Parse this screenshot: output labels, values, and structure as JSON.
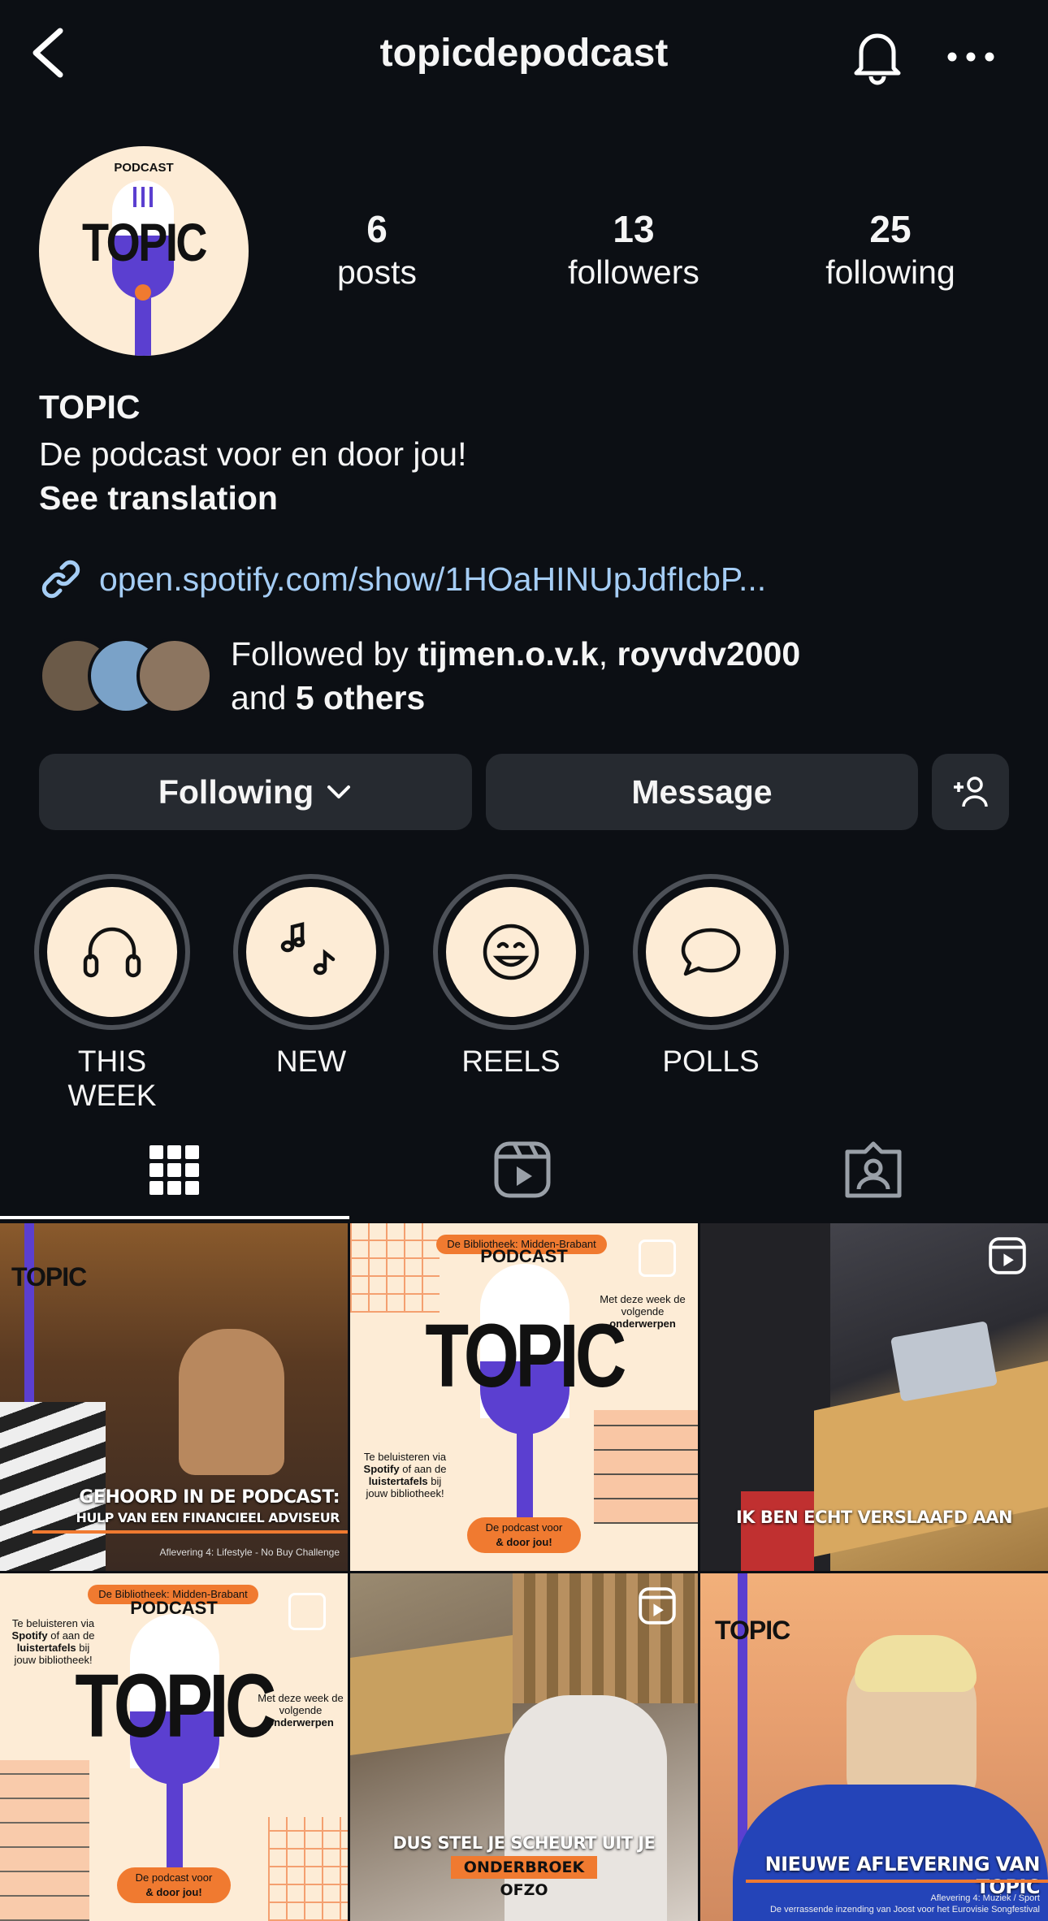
{
  "header": {
    "username": "topicdepodcast"
  },
  "profile": {
    "avatar_text_small": "PODCAST",
    "avatar_text_big": "TOPIC",
    "stats": [
      {
        "value": "6",
        "label": "posts"
      },
      {
        "value": "13",
        "label": "followers"
      },
      {
        "value": "25",
        "label": "following"
      }
    ],
    "name": "TOPIC",
    "bio": "De podcast voor en door jou!",
    "see_translation": "See translation",
    "link": "open.spotify.com/show/1HOaHINUpJdfIcbP...",
    "followed_prefix": "Followed by ",
    "followed_user1": "tijmen.o.v.k",
    "followed_sep": ", ",
    "followed_user2": "royvdv2000",
    "followed_and": "and ",
    "followed_others": "5 others"
  },
  "buttons": {
    "following": "Following",
    "message": "Message"
  },
  "highlights": [
    {
      "label": "THIS WEEK",
      "icon": "headphones-icon"
    },
    {
      "label": "NEW",
      "icon": "music-notes-icon"
    },
    {
      "label": "REELS",
      "icon": "smiley-icon"
    },
    {
      "label": "POLLS",
      "icon": "speech-bubble-icon"
    }
  ],
  "posts": [
    {
      "title": "GEHOORD IN DE PODCAST:",
      "subtitle": "HULP VAN EEN FINANCIEEL ADVISEUR",
      "footer": "Aflevering 4: Lifestyle - No Buy Challenge",
      "logo": "TOPIC"
    },
    {
      "tag": "De Bibliotheek: Midden-Brabant",
      "small": "PODCAST",
      "big": "TOPIC",
      "side_note": "Met deze week de volgende",
      "side_bold": "onderwerpen",
      "left_note": "Te beluisteren via",
      "left_b1": "Spotify",
      "left_mid": "of aan de",
      "left_b2": "luistertafels",
      "left_end": "bij jouw bibliotheek!",
      "pill": "De podcast voor",
      "pill2": "& door jou!"
    },
    {
      "caption": "IK BEN ECHT VERSLAAFD AAN"
    },
    {
      "tag": "De Bibliotheek: Midden-Brabant",
      "small": "PODCAST",
      "big": "TOPIC",
      "side_note": "Met deze week de volgende",
      "side_bold": "onderwerpen",
      "left_note": "Te beluisteren via",
      "left_b1": "Spotify",
      "left_mid": "of aan de",
      "left_b2": "luistertafels",
      "left_end": "bij jouw bibliotheek!",
      "pill": "De podcast voor",
      "pill2": "& door jou!"
    },
    {
      "caption": "DUS STEL JE SCHEURT UIT JE",
      "caption2": "ONDERBROEK OFZO"
    },
    {
      "logo": "TOPIC",
      "title": "NIEUWE AFLEVERING VAN TOPIC",
      "footer": "Aflevering 4: Muziek / Sport",
      "footer2": "De verrassende inzending van Joost voor het Eurovisie Songfestival"
    }
  ],
  "colors": {
    "bg": "#0c0f14",
    "button": "#262a30",
    "link": "#a5cdf5",
    "cream": "#fdecd6",
    "purple": "#5b3fd0",
    "orange": "#f07a30"
  }
}
